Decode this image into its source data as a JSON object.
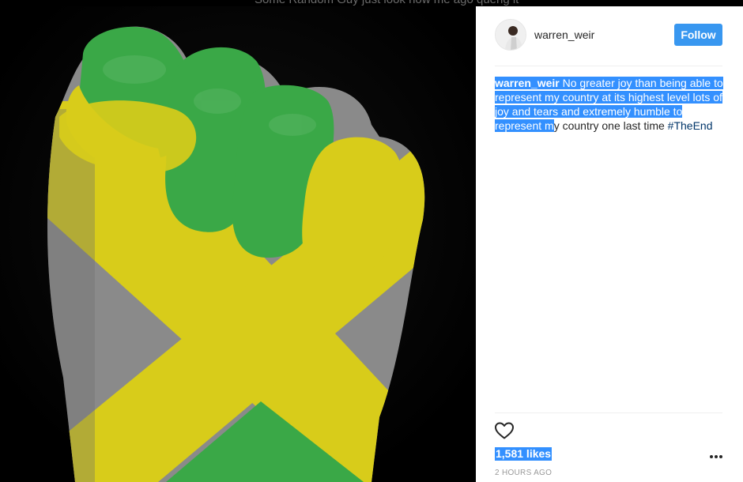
{
  "background_text": "Some Random Guy just look how me ago queng it",
  "post": {
    "image_alt": "Fist painted in Jamaican flag colors",
    "author": "warren_weir",
    "follow_label": "Follow",
    "caption_selected_part": " No greater joy than being able to represent my country at its highest level lots of joy and tears and extremely humble to represent m",
    "caption_rest": "y country one last time ",
    "hashtag": "#TheEnd",
    "likes": "1,581 likes",
    "timestamp": "2 HOURS AGO"
  },
  "icons": {
    "like": "heart-outline-icon",
    "more": "more-options-icon"
  },
  "colors": {
    "follow_button": "#3897f0",
    "selection": "#3390ff",
    "flag_green": "#3aa847",
    "flag_yellow": "#d8cc1a",
    "skin_gray": "#8a8a8a"
  }
}
